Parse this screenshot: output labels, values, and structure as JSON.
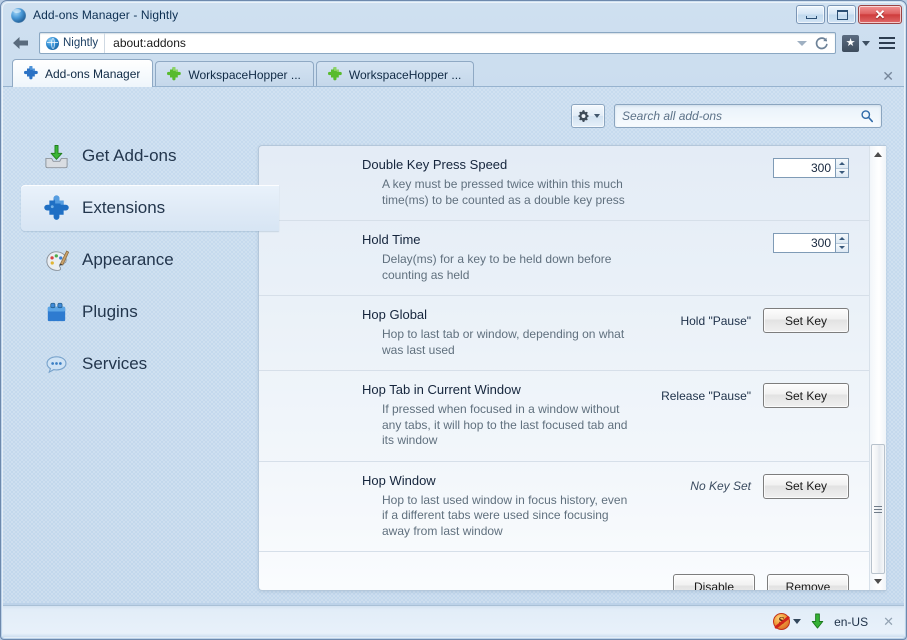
{
  "window": {
    "title": "Add-ons Manager - Nightly",
    "app_icon": "globe-icon",
    "minimize_label": "Minimize",
    "maximize_label": "Restore",
    "close_label": "✕"
  },
  "navbar": {
    "back_label": "Back",
    "identity_label": "Nightly",
    "url": "about:addons",
    "dropdown_label": "History dropdown",
    "reload_label": "Reload",
    "bookmark_label": "Bookmarks",
    "menu_label": "Open menu"
  },
  "tabs": [
    {
      "label": "Add-ons Manager",
      "icon": "addons-puzzle-icon",
      "active": true
    },
    {
      "label": "WorkspaceHopper ...",
      "icon": "puzzle-green-icon",
      "active": false
    },
    {
      "label": "WorkspaceHopper ...",
      "icon": "puzzle-green-icon",
      "active": false
    }
  ],
  "tabstrip": {
    "close_label": "✕"
  },
  "toolbar": {
    "gear_label": "Tools for all add-ons",
    "gear_icon": "gear-icon"
  },
  "search": {
    "placeholder": "Search all add-ons",
    "value": "",
    "icon": "search-icon"
  },
  "sidebar": {
    "items": [
      {
        "label": "Get Add-ons",
        "icon": "get-addons-icon",
        "selected": false
      },
      {
        "label": "Extensions",
        "icon": "extensions-puzzle-icon",
        "selected": true
      },
      {
        "label": "Appearance",
        "icon": "appearance-palette-icon",
        "selected": false
      },
      {
        "label": "Plugins",
        "icon": "plugins-icon",
        "selected": false
      },
      {
        "label": "Services",
        "icon": "services-chat-icon",
        "selected": false
      }
    ]
  },
  "detail": {
    "preferences": [
      {
        "title": "Double Key Press Speed",
        "description": "A key must be pressed twice within this much time(ms) to be counted as a double key press",
        "control": "spinner",
        "value": "300"
      },
      {
        "title": "Hold Time",
        "description": "Delay(ms) for a key to be held down before counting as held",
        "control": "spinner",
        "value": "300"
      },
      {
        "title": "Hop Global",
        "description": "Hop to last tab or window, depending on what was last used",
        "control": "setkey",
        "key_value": "Hold \"Pause\"",
        "key_unset": false,
        "button_label": "Set Key"
      },
      {
        "title": "Hop Tab in Current Window",
        "description": "If pressed when focused in a window without any tabs, it will hop to the last focused tab and its window",
        "control": "setkey",
        "key_value": "Release \"Pause\"",
        "key_unset": false,
        "button_label": "Set Key"
      },
      {
        "title": "Hop Window",
        "description": "Hop to last used window in focus history, even if a different tabs were used since focusing away from last window",
        "control": "setkey",
        "key_value": "No Key Set",
        "key_unset": true,
        "button_label": "Set Key"
      }
    ],
    "footer": {
      "disable_accesskey": "D",
      "disable_rest": "isable",
      "remove_accesskey": "R",
      "remove_rest": "emove"
    },
    "scrollbar": {
      "up_label": "Scroll up",
      "down_label": "Scroll down",
      "thumb_label": "Scroll thumb"
    }
  },
  "statusbar": {
    "noscript_label": "S",
    "noscript_icon": "noscript-icon",
    "download_icon": "download-arrow-icon",
    "language": "en-US",
    "close_label": "✕"
  },
  "colors": {
    "chrome_blue": "#c3d7ec",
    "frame_border": "#6d89ad",
    "close_red": "#cf3c3c",
    "accent_blue": "#2f8ad0",
    "text_dark": "#15253c",
    "text_muted": "#60707e",
    "download_green": "#2fa02f"
  }
}
